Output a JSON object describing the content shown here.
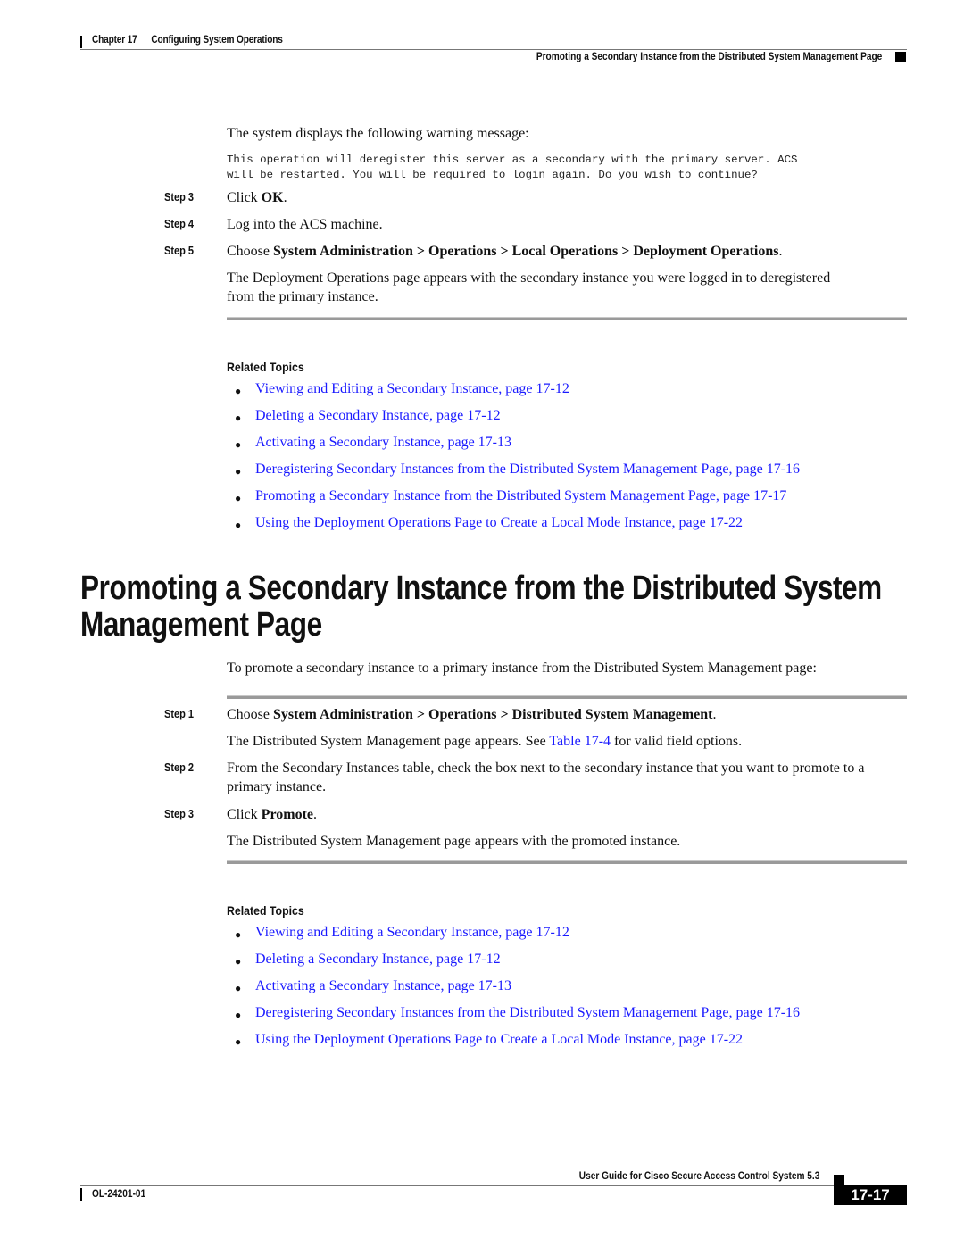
{
  "header": {
    "chapter": "Chapter 17",
    "chapter_title": "Configuring System Operations",
    "section_title": "Promoting a Secondary Instance from the Distributed System Management Page"
  },
  "top_section": {
    "intro": "The system displays the following warning message:",
    "warning_lines": [
      "This operation will deregister this server as a secondary with the primary server. ACS",
      "will be restarted. You will be required to login again. Do you wish to continue?"
    ],
    "steps": [
      {
        "label": "Step 3",
        "pre": "Click ",
        "bold": "OK",
        "post": "."
      },
      {
        "label": "Step 4",
        "pre": "Log into the ACS machine.",
        "bold": "",
        "post": ""
      },
      {
        "label": "Step 5",
        "pre": "Choose ",
        "bold": "System Administration > Operations > Local Operations > Deployment Operations",
        "post": "."
      }
    ],
    "step5_result": "The Deployment Operations page appears with the secondary instance you were logged in to deregistered from the primary instance.",
    "related_title": "Related Topics",
    "related": [
      "Viewing and Editing a Secondary Instance, page 17-12",
      "Deleting a Secondary Instance, page 17-12",
      "Activating a Secondary Instance, page 17-13",
      "Deregistering Secondary Instances from the Distributed System Management Page, page 17-16",
      "Promoting a Secondary Instance from the Distributed System Management Page, page 17-17",
      "Using the Deployment Operations Page to Create a Local Mode Instance, page 17-22"
    ]
  },
  "main_section": {
    "heading_line1": "Promoting a Secondary Instance from the Distributed System",
    "heading_line2": "Management Page",
    "intro": "To promote a secondary instance to a primary instance from the Distributed System Management page:",
    "steps": [
      {
        "label": "Step 1",
        "pre": "Choose ",
        "bold": "System Administration > Operations > Distributed System Management",
        "post": "."
      },
      {
        "label": "Step 2",
        "pre": "From the Secondary Instances table, check the box next to the secondary instance that you want to promote to a primary instance.",
        "bold": "",
        "post": ""
      },
      {
        "label": "Step 3",
        "pre": "Click ",
        "bold": "Promote",
        "post": "."
      }
    ],
    "step1_result_pre": "The Distributed System Management page appears. See ",
    "step1_result_link": "Table 17-4",
    "step1_result_post": " for valid field options.",
    "step3_result": "The Distributed System Management page appears with the promoted instance.",
    "related_title": "Related Topics",
    "related": [
      "Viewing and Editing a Secondary Instance, page 17-12",
      "Deleting a Secondary Instance, page 17-12",
      "Activating a Secondary Instance, page 17-13",
      "Deregistering Secondary Instances from the Distributed System Management Page, page 17-16",
      "Using the Deployment Operations Page to Create a Local Mode Instance, page 17-22"
    ]
  },
  "footer": {
    "guide_title": "User Guide for Cisco Secure Access Control System 5.3",
    "doc_number": "OL-24201-01",
    "page_number": "17-17"
  },
  "colors": {
    "link": "#1a1aff",
    "rule": "#9a9a9a"
  }
}
